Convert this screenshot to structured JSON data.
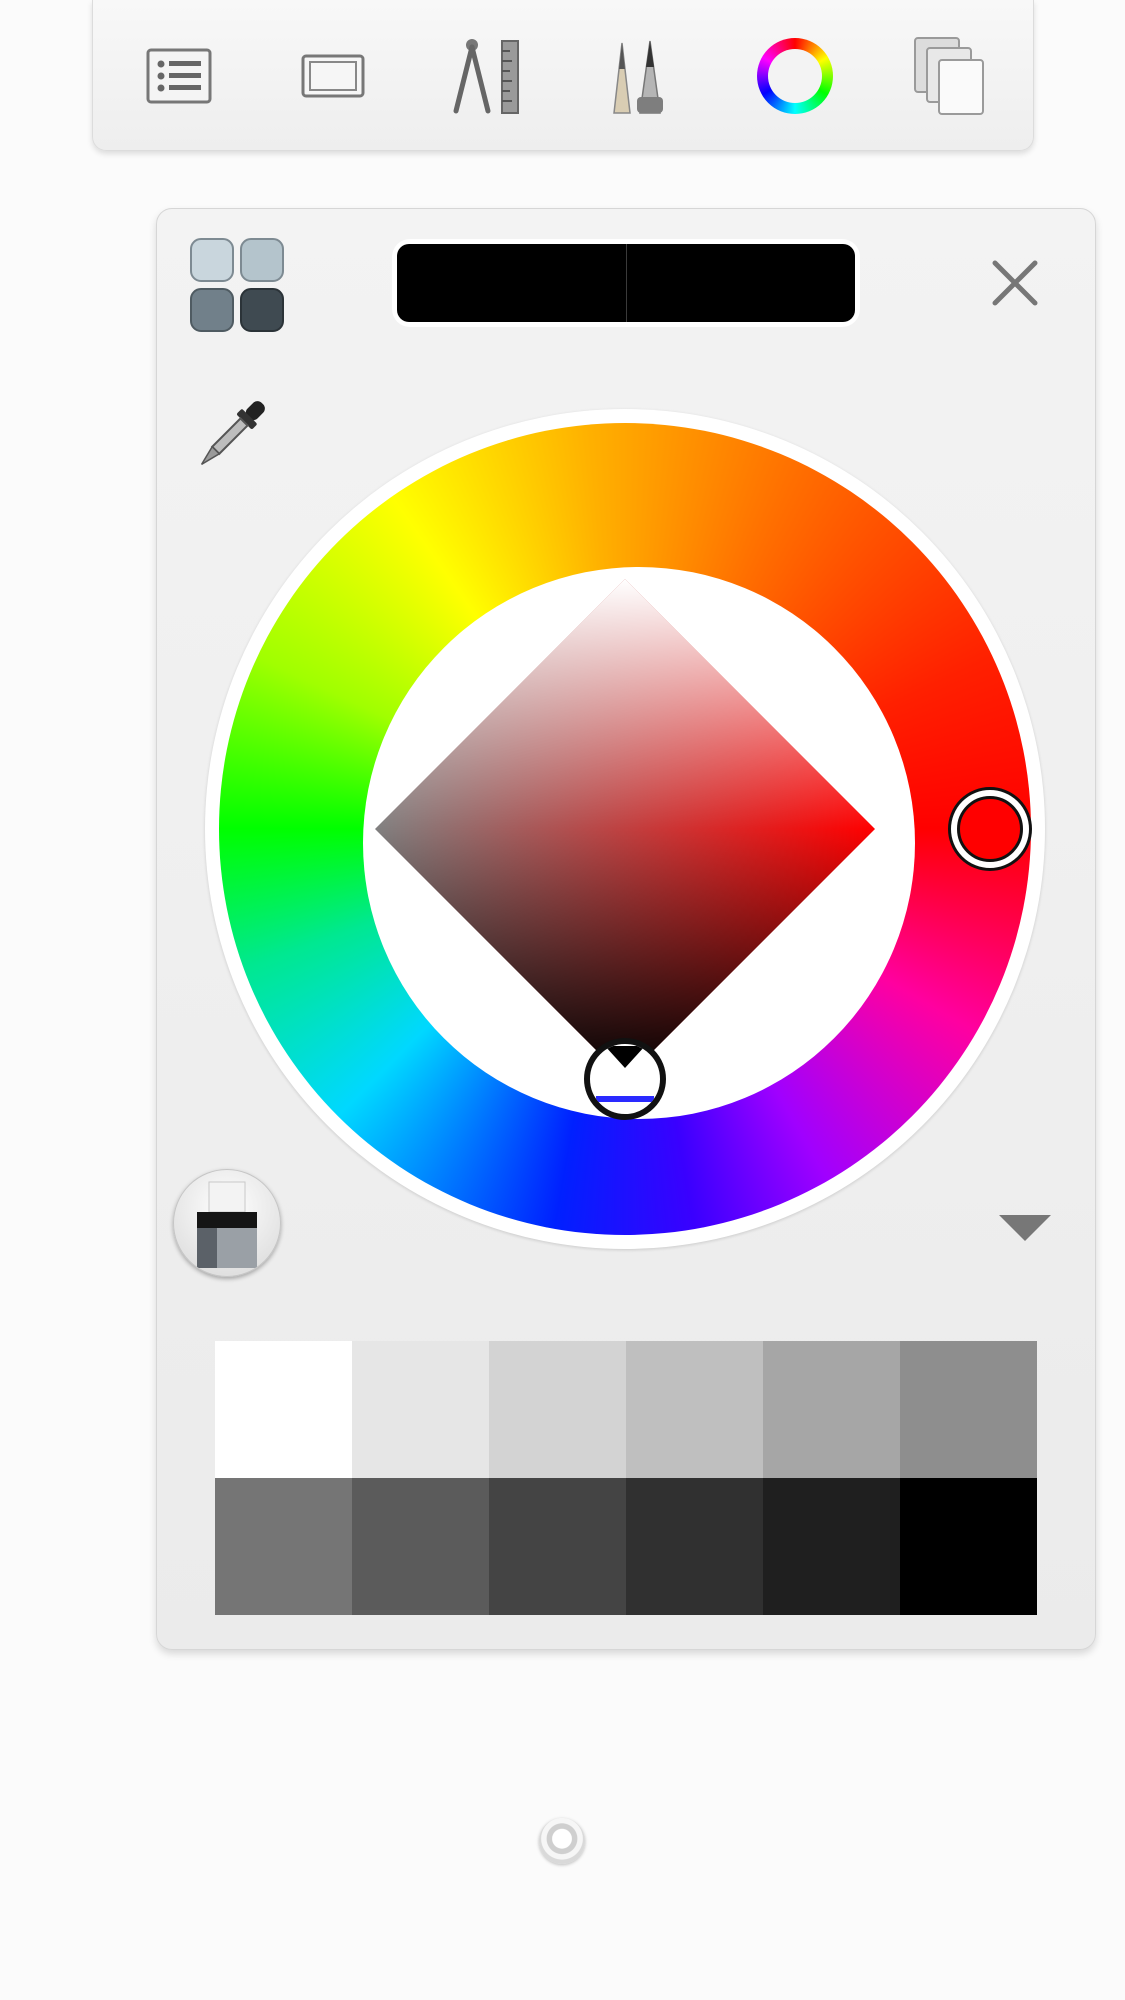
{
  "toolbar": {
    "buttons": [
      {
        "id": "layers",
        "icon": "list-icon"
      },
      {
        "id": "canvas",
        "icon": "canvas-frame-icon"
      },
      {
        "id": "guides",
        "icon": "compass-ruler-icon"
      },
      {
        "id": "brushes",
        "icon": "pencils-icon"
      },
      {
        "id": "colors",
        "icon": "color-wheel-icon"
      },
      {
        "id": "copy",
        "icon": "copy-pages-icon"
      }
    ]
  },
  "color_panel": {
    "swatch_grid_icon": "swatch-grid-icon",
    "swatch_grid_colors": [
      "#c9d6dd",
      "#b4c4cc",
      "#71808a",
      "#3f4a51"
    ],
    "current_color": "#000000",
    "previous_color": "#000000",
    "close_icon": "close-icon",
    "eyedropper_icon": "eyedropper-icon",
    "selected_hue": "#ff0000",
    "blend_brush_icon": "brush-icon",
    "expand_icon": "chevron-down-icon",
    "palette": [
      "#ffffff",
      "#e6e6e6",
      "#d3d3d3",
      "#bfbfbf",
      "#a6a6a6",
      "#8e8e8e",
      "#757575",
      "#5b5b5b",
      "#444444",
      "#303030",
      "#1f1f1f",
      "#000000"
    ]
  },
  "home_indicator": "home-indicator"
}
